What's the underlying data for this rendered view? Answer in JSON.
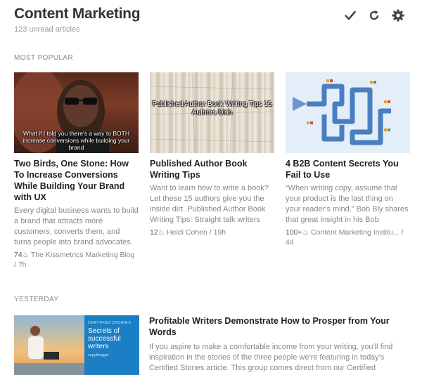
{
  "header": {
    "title": "Content Marketing",
    "subtitle": "123 unread articles",
    "icons": [
      "check-icon",
      "refresh-icon",
      "gear-icon"
    ]
  },
  "sections": {
    "popular": "MOST POPULAR",
    "yesterday": "YESTERDAY"
  },
  "cards": [
    {
      "image_text": "What if I told you there's a way to BOTH increase conversions while building your brand",
      "title": "Two Birds, One Stone: How To Increase Conversions While Building Your Brand with UX",
      "snippet": "Every digital business wants to build a brand that attracts more customers, converts them, and turns people into brand advocates.",
      "count": "74",
      "meta": "The Kissmetrics Marketing Blog / 7h"
    },
    {
      "image_text": "Published Author Book Writing Tips 15 Authors Dish",
      "title": "Published Author Book Writing Tips",
      "snippet": "Want to learn how to write a book? Let these 15 authors give you the inside dirt. Published Author Book Writing Tips: Straight talk writers",
      "count": "12",
      "meta": "Heidi Cohen / 19h"
    },
    {
      "image_text": "",
      "title": "4 B2B Content Secrets You Fail to Use",
      "snippet": "“When writing copy, assume that your product is the last thing on your reader's mind.” Bob Bly shares that great insight in his Bob",
      "count": "100+",
      "meta": "Content Marketing Institu... / 4d"
    }
  ],
  "yesterday_item": {
    "image_text": {
      "kicker": "CERTIFIED STORIES",
      "headline": "Secrets of successful writers",
      "brand": "copyblogger"
    },
    "title": "Profitable Writers Demonstrate How to Prosper from Your Words",
    "snippet": "If you aspire to make a comfortable income from your writing, you'll find inspiration in the stories of the three people we're featuring in today's Certified Stories article. This group comes direct from our Certified"
  },
  "colors": {
    "accent": "#2bb24c",
    "text": "#222222",
    "muted": "#888888"
  }
}
